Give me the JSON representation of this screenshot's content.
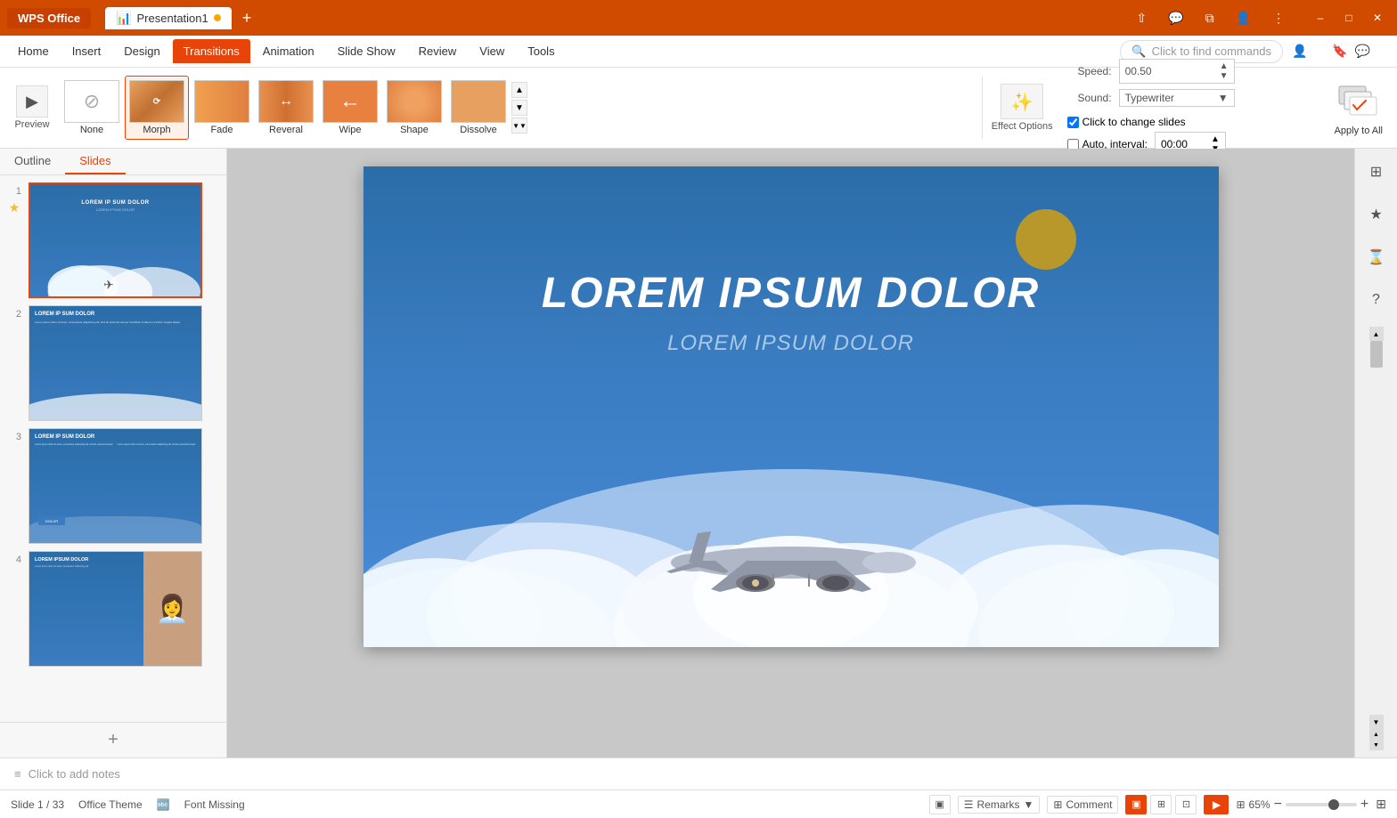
{
  "titlebar": {
    "wps_label": "WPS Office",
    "doc_name": "Presentation1",
    "add_tab": "+",
    "minimize": "–",
    "maximize": "□",
    "close": "✕",
    "avatar_icon": "👤"
  },
  "ribbon": {
    "tabs": [
      {
        "id": "home",
        "label": "Home"
      },
      {
        "id": "insert",
        "label": "Insert"
      },
      {
        "id": "design",
        "label": "Design"
      },
      {
        "id": "transitions",
        "label": "Transitions",
        "active": true
      },
      {
        "id": "animation",
        "label": "Animation"
      },
      {
        "id": "slideshow",
        "label": "Slide Show"
      },
      {
        "id": "review",
        "label": "Review"
      },
      {
        "id": "view",
        "label": "View"
      },
      {
        "id": "tools",
        "label": "Tools"
      }
    ],
    "search_placeholder": "Click to find commands",
    "preview_label": "Preview",
    "transitions": [
      {
        "id": "none",
        "label": "None",
        "active": false
      },
      {
        "id": "morph",
        "label": "Morph",
        "active": true
      },
      {
        "id": "fade",
        "label": "Fade",
        "active": false
      },
      {
        "id": "reveral",
        "label": "Reveral",
        "active": false
      },
      {
        "id": "wipe",
        "label": "Wipe",
        "active": false
      },
      {
        "id": "shape",
        "label": "Shape",
        "active": false
      },
      {
        "id": "dissolve",
        "label": "Dissolve",
        "active": false
      }
    ],
    "effect_options_label": "Effect Options",
    "speed_label": "Speed:",
    "speed_value": "00.50",
    "sound_label": "Sound:",
    "sound_value": "Typewriter",
    "click_to_change_label": "Click to change slides",
    "auto_interval_label": "Auto, interval:",
    "auto_interval_value": "00:00",
    "apply_all_label": "Apply to All"
  },
  "slide_panel": {
    "tabs": [
      {
        "id": "outline",
        "label": "Outline"
      },
      {
        "id": "slides",
        "label": "Slides",
        "active": true
      }
    ],
    "slides": [
      {
        "num": 1,
        "active": true,
        "title": "LOREM IPSUM DOLOR",
        "subtitle": "LOREM IPSUM DOLOR"
      },
      {
        "num": 2,
        "active": false,
        "title": "LOREM IP SUM DOLOR"
      },
      {
        "num": 3,
        "active": false,
        "title": "LOREM IP SUM DOLOR"
      },
      {
        "num": 4,
        "active": false,
        "title": "LOREM IPSUM DOLOR"
      }
    ],
    "add_slide_label": "+"
  },
  "main_slide": {
    "title": "LOREM IPSUM DOLOR",
    "subtitle": "LOREM IPSUM DOLOR"
  },
  "statusbar": {
    "slide_info": "Slide 1 / 33",
    "theme": "Office Theme",
    "font_missing": "Font Missing",
    "remarks_label": "Remarks",
    "comment_label": "Comment",
    "zoom_level": "65%",
    "normal_view": "▣",
    "grid_view": "⊞",
    "reader_view": "⊡"
  },
  "notes": {
    "placeholder": "Click to add notes"
  },
  "right_panel_icons": [
    "✦",
    "★",
    "⌛",
    "?"
  ]
}
